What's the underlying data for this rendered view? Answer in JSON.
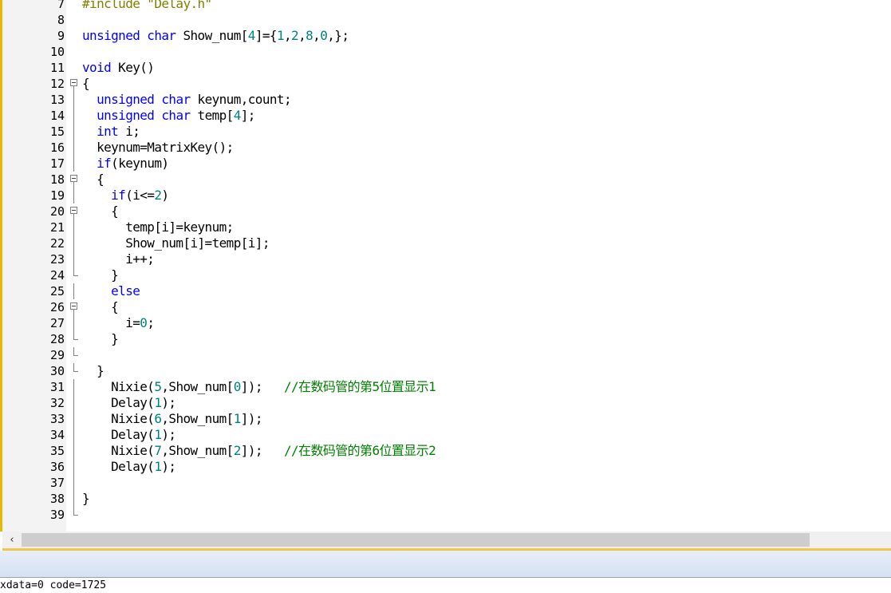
{
  "editor": {
    "lines": [
      {
        "n": "7",
        "fold": "",
        "code": [
          {
            "t": "#include \"Delay.h\"",
            "c": "pp"
          }
        ]
      },
      {
        "n": "8",
        "fold": "",
        "code": []
      },
      {
        "n": "9",
        "fold": "",
        "code": [
          {
            "t": "unsigned char",
            "c": "kw"
          },
          {
            "t": " Show_num[",
            "c": ""
          },
          {
            "t": "4",
            "c": "num"
          },
          {
            "t": "]={",
            "c": ""
          },
          {
            "t": "1",
            "c": "num"
          },
          {
            "t": ",",
            "c": ""
          },
          {
            "t": "2",
            "c": "num"
          },
          {
            "t": ",",
            "c": ""
          },
          {
            "t": "8",
            "c": "num"
          },
          {
            "t": ",",
            "c": ""
          },
          {
            "t": "0",
            "c": "num"
          },
          {
            "t": ",};",
            "c": ""
          }
        ]
      },
      {
        "n": "10",
        "fold": "",
        "code": []
      },
      {
        "n": "11",
        "fold": "",
        "code": [
          {
            "t": "void",
            "c": "kw"
          },
          {
            "t": " Key()",
            "c": ""
          }
        ]
      },
      {
        "n": "12",
        "fold": "open",
        "code": [
          {
            "t": "{",
            "c": ""
          }
        ]
      },
      {
        "n": "13",
        "fold": "line",
        "code": [
          {
            "t": "  ",
            "c": ""
          },
          {
            "t": "unsigned char",
            "c": "kw"
          },
          {
            "t": " keynum,count;",
            "c": ""
          }
        ]
      },
      {
        "n": "14",
        "fold": "line",
        "code": [
          {
            "t": "  ",
            "c": ""
          },
          {
            "t": "unsigned char",
            "c": "kw"
          },
          {
            "t": " temp[",
            "c": ""
          },
          {
            "t": "4",
            "c": "num"
          },
          {
            "t": "];",
            "c": ""
          }
        ]
      },
      {
        "n": "15",
        "fold": "line",
        "code": [
          {
            "t": "  ",
            "c": ""
          },
          {
            "t": "int",
            "c": "kw"
          },
          {
            "t": " i;",
            "c": ""
          }
        ]
      },
      {
        "n": "16",
        "fold": "line",
        "code": [
          {
            "t": "  keynum=MatrixKey();",
            "c": ""
          }
        ]
      },
      {
        "n": "17",
        "fold": "line",
        "code": [
          {
            "t": "  ",
            "c": ""
          },
          {
            "t": "if",
            "c": "kw"
          },
          {
            "t": "(keynum)",
            "c": ""
          }
        ]
      },
      {
        "n": "18",
        "fold": "open",
        "code": [
          {
            "t": "  {",
            "c": ""
          }
        ]
      },
      {
        "n": "19",
        "fold": "line",
        "code": [
          {
            "t": "    ",
            "c": ""
          },
          {
            "t": "if",
            "c": "kw"
          },
          {
            "t": "(i<=",
            "c": ""
          },
          {
            "t": "2",
            "c": "num"
          },
          {
            "t": ")",
            "c": ""
          }
        ]
      },
      {
        "n": "20",
        "fold": "open",
        "code": [
          {
            "t": "    {",
            "c": ""
          }
        ]
      },
      {
        "n": "21",
        "fold": "line",
        "code": [
          {
            "t": "      temp[i]=keynum;",
            "c": ""
          }
        ]
      },
      {
        "n": "22",
        "fold": "line",
        "code": [
          {
            "t": "      Show_num[i]=temp[i];",
            "c": ""
          }
        ]
      },
      {
        "n": "23",
        "fold": "line",
        "code": [
          {
            "t": "      i++;",
            "c": ""
          }
        ]
      },
      {
        "n": "24",
        "fold": "end",
        "code": [
          {
            "t": "    }",
            "c": ""
          }
        ]
      },
      {
        "n": "25",
        "fold": "line",
        "code": [
          {
            "t": "    ",
            "c": ""
          },
          {
            "t": "else",
            "c": "kw"
          }
        ]
      },
      {
        "n": "26",
        "fold": "open",
        "code": [
          {
            "t": "    {",
            "c": ""
          }
        ]
      },
      {
        "n": "27",
        "fold": "line",
        "code": [
          {
            "t": "      i=",
            "c": ""
          },
          {
            "t": "0",
            "c": "num"
          },
          {
            "t": ";",
            "c": ""
          }
        ]
      },
      {
        "n": "28",
        "fold": "end",
        "code": [
          {
            "t": "    }",
            "c": ""
          }
        ]
      },
      {
        "n": "29",
        "fold": "end",
        "code": []
      },
      {
        "n": "30",
        "fold": "end",
        "code": [
          {
            "t": "  }",
            "c": ""
          }
        ]
      },
      {
        "n": "31",
        "fold": "line",
        "code": [
          {
            "t": "    Nixie(",
            "c": ""
          },
          {
            "t": "5",
            "c": "num"
          },
          {
            "t": ",Show_num[",
            "c": ""
          },
          {
            "t": "0",
            "c": "num"
          },
          {
            "t": "]);   ",
            "c": ""
          },
          {
            "t": "//在数码管的第5位置显示1",
            "c": "cm"
          }
        ]
      },
      {
        "n": "32",
        "fold": "line",
        "code": [
          {
            "t": "    Delay(",
            "c": ""
          },
          {
            "t": "1",
            "c": "num"
          },
          {
            "t": ");",
            "c": ""
          }
        ]
      },
      {
        "n": "33",
        "fold": "line",
        "code": [
          {
            "t": "    Nixie(",
            "c": ""
          },
          {
            "t": "6",
            "c": "num"
          },
          {
            "t": ",Show_num[",
            "c": ""
          },
          {
            "t": "1",
            "c": "num"
          },
          {
            "t": "]);",
            "c": ""
          }
        ]
      },
      {
        "n": "34",
        "fold": "line",
        "code": [
          {
            "t": "    Delay(",
            "c": ""
          },
          {
            "t": "1",
            "c": "num"
          },
          {
            "t": ");",
            "c": ""
          }
        ]
      },
      {
        "n": "35",
        "fold": "line",
        "code": [
          {
            "t": "    Nixie(",
            "c": ""
          },
          {
            "t": "7",
            "c": "num"
          },
          {
            "t": ",Show_num[",
            "c": ""
          },
          {
            "t": "2",
            "c": "num"
          },
          {
            "t": "]);   ",
            "c": ""
          },
          {
            "t": "//在数码管的第6位置显示2",
            "c": "cm"
          }
        ]
      },
      {
        "n": "36",
        "fold": "line",
        "code": [
          {
            "t": "    Delay(",
            "c": ""
          },
          {
            "t": "1",
            "c": "num"
          },
          {
            "t": ");",
            "c": ""
          }
        ]
      },
      {
        "n": "37",
        "fold": "line",
        "code": []
      },
      {
        "n": "38",
        "fold": "line",
        "code": [
          {
            "t": "}",
            "c": ""
          }
        ]
      },
      {
        "n": "39",
        "fold": "end",
        "code": []
      }
    ]
  },
  "scrollbar": {
    "left_arrow": "‹"
  },
  "output": {
    "text": "xdata=0 code=1725"
  }
}
